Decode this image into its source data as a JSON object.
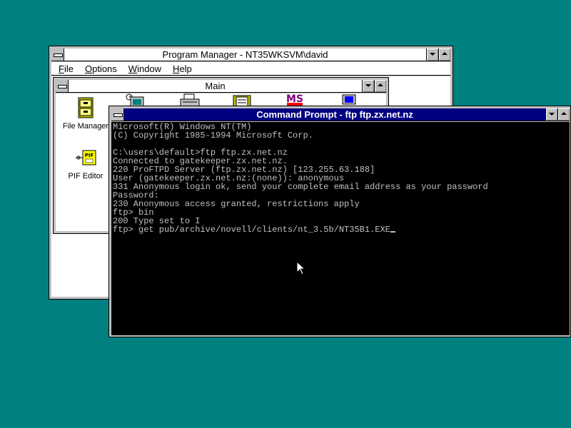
{
  "program_manager": {
    "title": "Program Manager - NT35WKSVM\\david",
    "menu": {
      "file": {
        "key": "F",
        "rest": "ile"
      },
      "options": {
        "key": "O",
        "rest": "ptions"
      },
      "window": {
        "key": "W",
        "rest": "indow"
      },
      "help": {
        "key": "H",
        "rest": "elp"
      }
    },
    "main_group": {
      "title": "Main",
      "icons": {
        "file_manager": "File Manager",
        "pif_editor": "PIF Editor"
      }
    }
  },
  "command_prompt": {
    "title": "Command Prompt - ftp ftp.zx.net.nz",
    "lines": [
      "Microsoft(R) Windows NT(TM)",
      "(C) Copyright 1985-1994 Microsoft Corp.",
      "",
      "C:\\users\\default>ftp ftp.zx.net.nz",
      "Connected to gatekeeper.zx.net.nz.",
      "220 ProFTPD Server (ftp.zx.net.nz) [123.255.63.188]",
      "User (gatekeeper.zx.net.nz:(none)): anonymous",
      "331 Anonymous login ok, send your complete email address as your password",
      "Password:",
      "230 Anonymous access granted, restrictions apply",
      "ftp> bin",
      "200 Type set to I",
      "ftp> get pub/archive/novell/clients/nt_3.5b/NT35B1.EXE"
    ]
  },
  "colors": {
    "desktop": "#008080",
    "active_title": "#000080",
    "console_bg": "#000000",
    "console_fg": "#c0c0c0"
  }
}
